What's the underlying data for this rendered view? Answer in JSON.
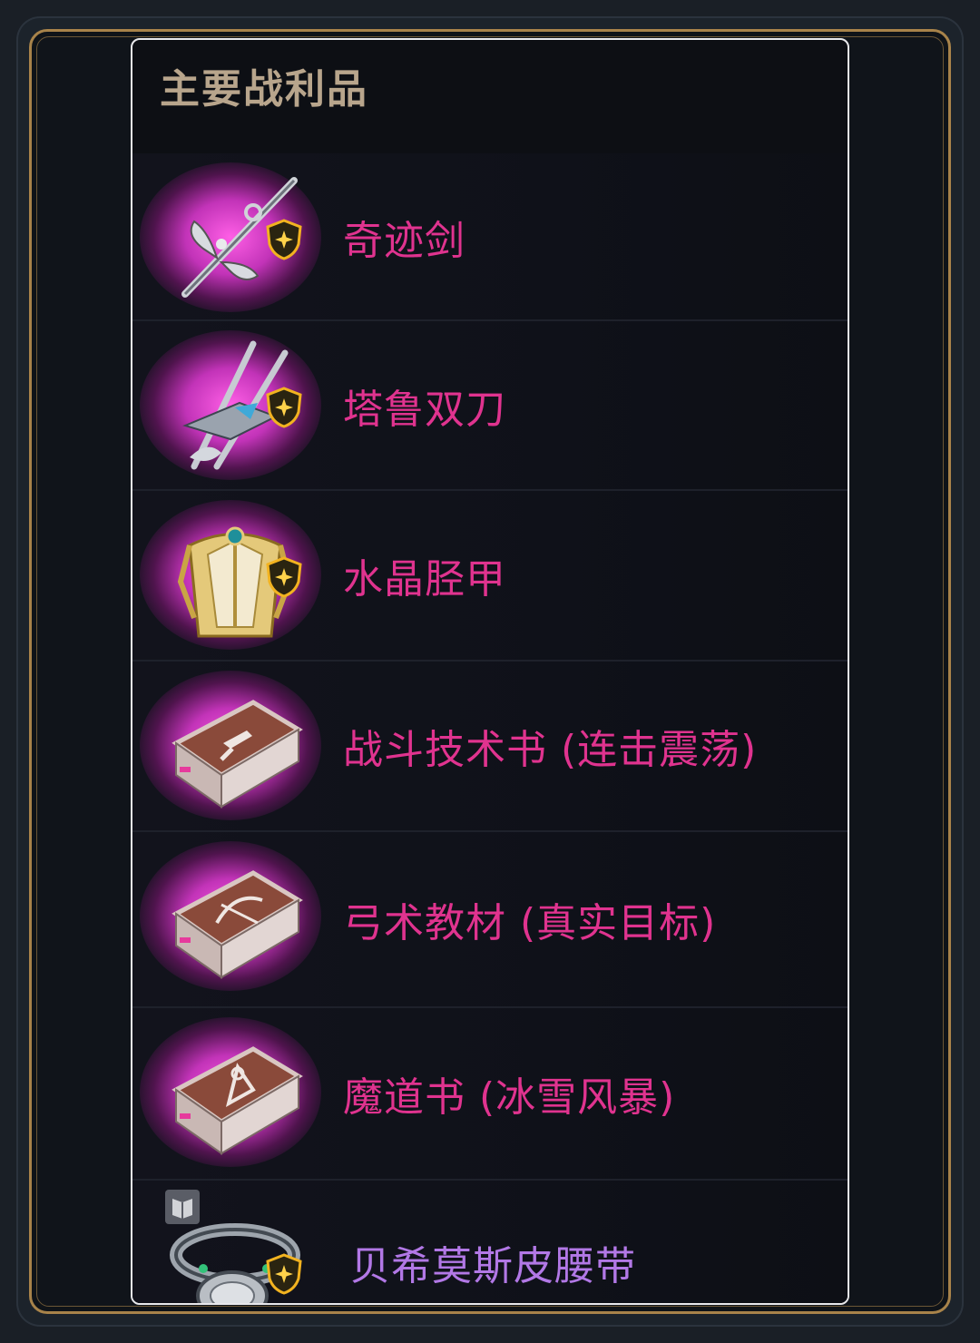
{
  "panel": {
    "title": "主要战利品",
    "items": [
      {
        "name": "奇迹剑",
        "icon": "sword-icon",
        "rarity": "legendary",
        "badge": "shield-badge-icon"
      },
      {
        "name": "塔鲁双刀",
        "icon": "dual-blades-icon",
        "rarity": "legendary",
        "badge": "shield-badge-icon"
      },
      {
        "name": "水晶胫甲",
        "icon": "greaves-icon",
        "rarity": "legendary",
        "badge": "shield-badge-icon"
      },
      {
        "name": "战斗技术书 (连击震荡)",
        "icon": "skill-book-icon",
        "rarity": "legendary"
      },
      {
        "name": "弓术教材 (真实目标)",
        "icon": "skill-book-icon",
        "rarity": "legendary"
      },
      {
        "name": "魔道书 (冰雪风暴)",
        "icon": "skill-book-icon",
        "rarity": "legendary"
      },
      {
        "name": "贝希莫斯皮腰带",
        "icon": "belt-icon",
        "rarity": "epic",
        "badge": "shield-badge-icon",
        "tag": "book-tag-icon"
      }
    ]
  },
  "colors": {
    "legendary": "#e0338f",
    "epic": "#b278e6",
    "title": "#b8a58c",
    "frame_gold": "#a8834a"
  }
}
